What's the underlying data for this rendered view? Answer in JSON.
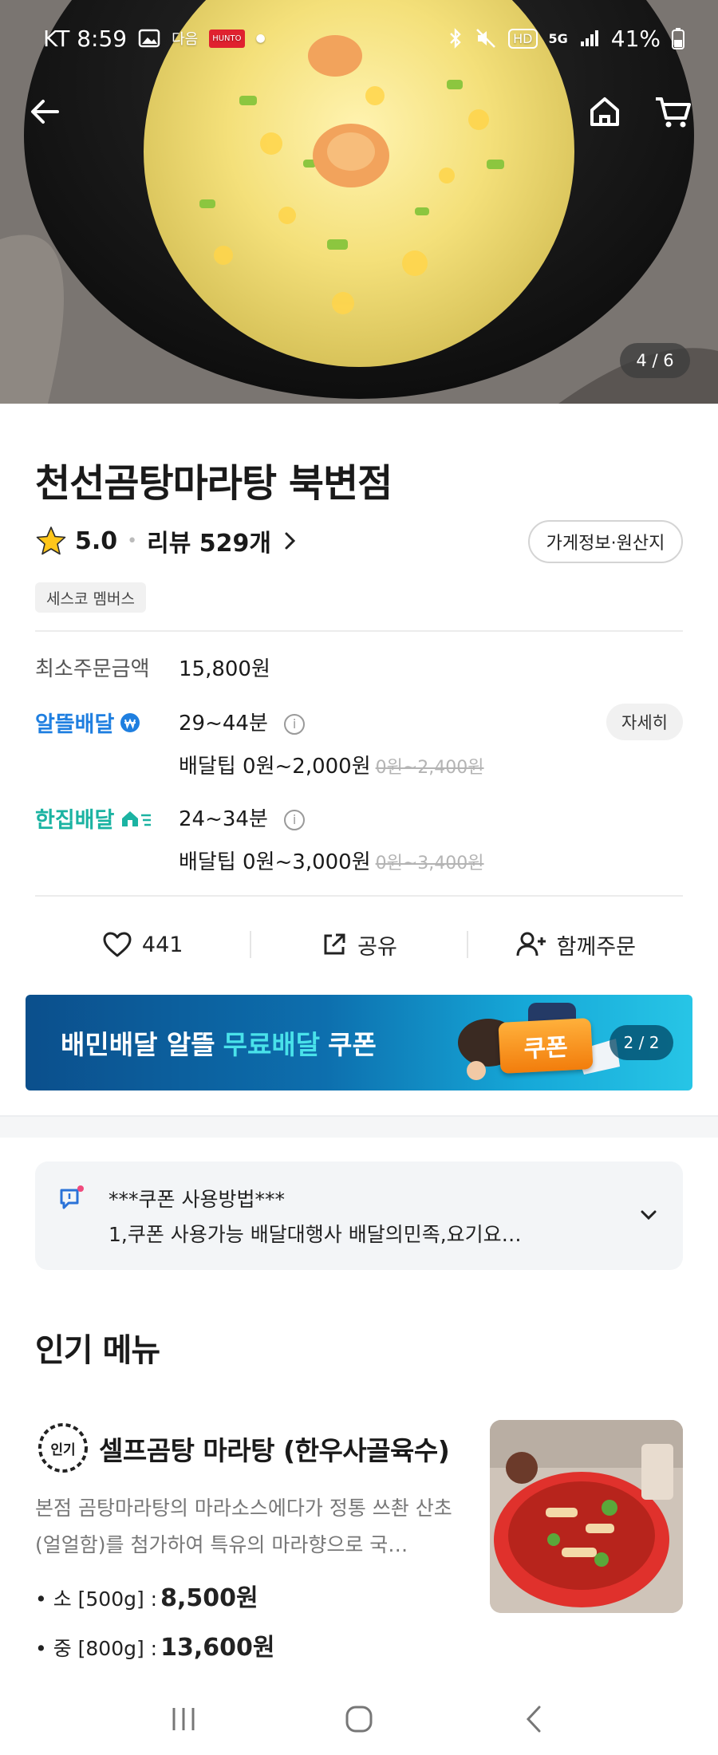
{
  "status_bar": {
    "carrier_time": "KT 8:59",
    "battery": "41%",
    "network": "5G",
    "hd_label": "HD",
    "tiny_app_label": "HUNTO",
    "tiny_app_label2": "다음"
  },
  "hero": {
    "page_indicator": "4 / 6"
  },
  "store": {
    "name": "천선곰탕마라탕 북변점",
    "rating": "5.0",
    "reviews": "리뷰 529개",
    "info_button": "가게정보·원산지",
    "membership_tag": "세스코 멤버스"
  },
  "order_info": {
    "min_order_label": "최소주문금액",
    "min_order_value": "15,800원",
    "saver_delivery": {
      "brand": "알뜰배달",
      "brand_color": "#1f7fe0",
      "time": "29~44분",
      "tip": "배달팁 0원~2,000원",
      "tip_original": "0원~2,400원",
      "detail_button": "자세히"
    },
    "single_delivery": {
      "brand": "한집배달",
      "brand_color": "#1bb3a2",
      "time": "24~34분",
      "tip": "배달팁 0원~3,000원",
      "tip_original": "0원~3,400원"
    }
  },
  "actions": {
    "like_count": "441",
    "share_label": "공유",
    "group_order_label": "함께주문"
  },
  "banner": {
    "text_part1": "배민배달 알뜰",
    "text_accent": "무료배달",
    "text_part2": "쿠폰",
    "coupon_label": "쿠폰",
    "counter": "2 / 2"
  },
  "notice": {
    "title": "***쿠폰 사용방법***",
    "body": "1,쿠폰 사용가능 배달대행사 배달의민족,요기요…"
  },
  "popular": {
    "section_title": "인기 메뉴",
    "badge_label": "인기",
    "item": {
      "name": "셀프곰탕 마라탕 (한우사골육수)",
      "description": "본점 곰탕마라탕의 마라소스에다가 정통 쓰촨 산초(얼얼함)를 첨가하여 특유의 마라향으로 국…",
      "prices": [
        {
          "label": "• 소 [500g] :",
          "amount": "8,500원"
        },
        {
          "label": "• 중 [800g] :",
          "amount": "13,600원"
        }
      ]
    }
  },
  "colors": {
    "brand_blue": "#1f7fe0",
    "brand_teal": "#1bb3a2",
    "banner_accent": "#49e2ea"
  }
}
